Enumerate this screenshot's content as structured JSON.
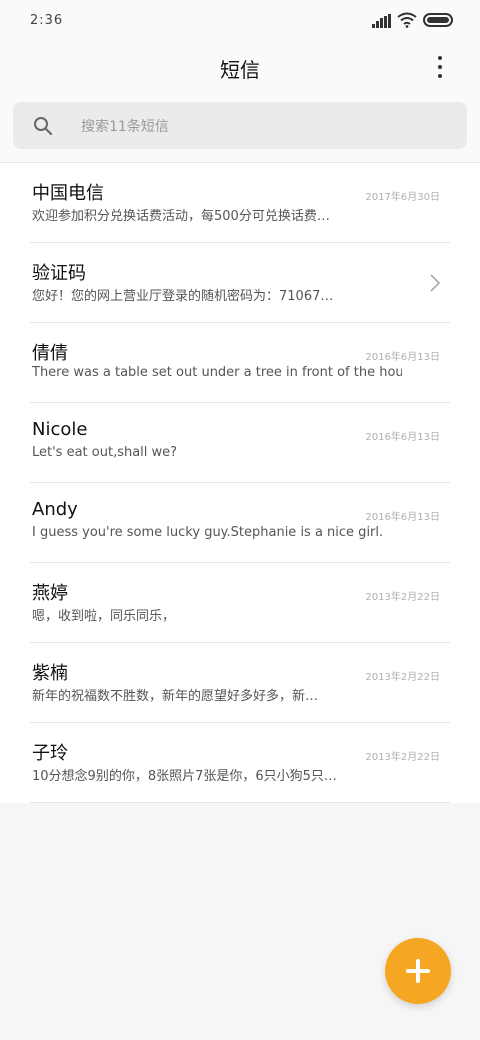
{
  "status_bar": {
    "time": "2:36",
    "icons": [
      "signal-icon",
      "wifi-icon",
      "battery-icon"
    ]
  },
  "header": {
    "title": "短信",
    "menu_icon": "more-vertical-icon"
  },
  "search": {
    "icon": "search-icon",
    "placeholder": "搜索11条短信"
  },
  "messages": [
    {
      "name": "中国电信",
      "date": "2017年6月30日",
      "preview": "欢迎参加积分兑换话费活动，每500分可兑换话费…"
    },
    {
      "name": "验证码",
      "date": "",
      "preview": "您好！您的网上营业厅登录的随机密码为：71067…",
      "has_chevron": true
    },
    {
      "name": "倩倩",
      "date": "2016年6月13日",
      "preview": "There was a table set out under a tree in front of the hous"
    },
    {
      "name": "Nicole",
      "date": "2016年6月13日",
      "preview": "Let's eat out,shall we?"
    },
    {
      "name": "Andy",
      "date": "2016年6月13日",
      "preview": "I guess you're some lucky guy.Stephanie is a nice girl."
    },
    {
      "name": "燕婷",
      "date": "2013年2月22日",
      "preview": "嗯，收到啦，同乐同乐，"
    },
    {
      "name": "紫楠",
      "date": "2013年2月22日",
      "preview": "新年的祝福数不胜数，新年的愿望好多好多，新…"
    },
    {
      "name": "子玲",
      "date": "2013年2月22日",
      "preview": "10分想念9别的你，8张照片7张是你，6只小狗5只…"
    }
  ],
  "fab": {
    "icon": "plus-icon"
  },
  "colors": {
    "accent": "#f5a623",
    "background": "#f6f6f6"
  }
}
